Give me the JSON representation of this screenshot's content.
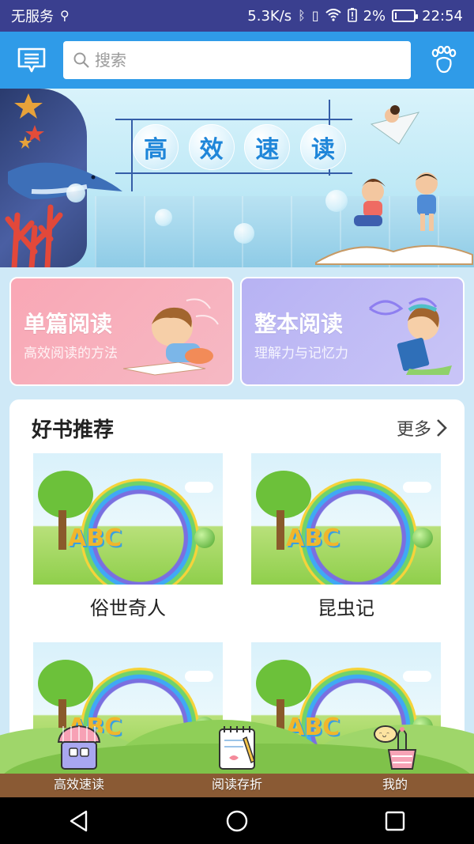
{
  "status_bar": {
    "carrier": "无服务",
    "network_speed": "5.3K/s",
    "battery_percent": "2%",
    "time": "22:54"
  },
  "header": {
    "search_placeholder": "搜索"
  },
  "banner": {
    "title_chars": [
      "高",
      "效",
      "速",
      "读"
    ]
  },
  "cards": [
    {
      "title": "单篇阅读",
      "subtitle": "高效阅读的方法",
      "color": "#f9a7b5"
    },
    {
      "title": "整本阅读",
      "subtitle": "理解力与记忆力",
      "color": "#b7b2f3"
    }
  ],
  "recommend": {
    "title": "好书推荐",
    "more_label": "更多",
    "books": [
      {
        "title": "俗世奇人"
      },
      {
        "title": "昆虫记"
      },
      {
        "title": ""
      },
      {
        "title": ""
      }
    ]
  },
  "bottom_nav": {
    "items": [
      {
        "label": "高效速读",
        "icon": "house-icon"
      },
      {
        "label": "阅读存折",
        "icon": "notebook-icon"
      },
      {
        "label": "我的",
        "icon": "cactus-icon"
      }
    ]
  },
  "colors": {
    "status_bar": "#3a3f8f",
    "header": "#2f9be8",
    "accent_text": "#1f86d9"
  }
}
